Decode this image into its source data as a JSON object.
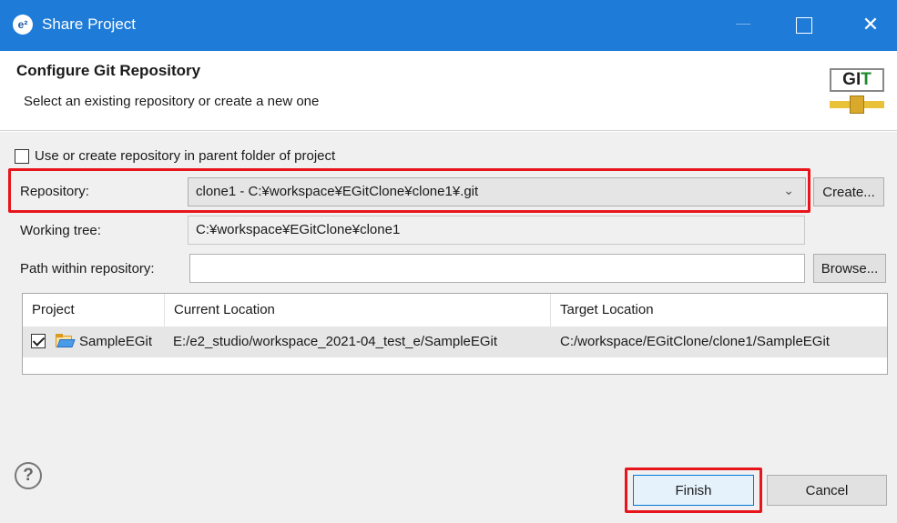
{
  "window": {
    "title": "Share Project",
    "app_icon_text": "e²",
    "close_glyph": "✕"
  },
  "banner": {
    "heading": "Configure Git Repository",
    "description": "Select an existing repository or create a new one",
    "logo_text_g": "G",
    "logo_text_i": "I",
    "logo_text_t": "T"
  },
  "form": {
    "use_parent_label": "Use or create repository in parent folder of project",
    "use_parent_checked": false,
    "repository_label": "Repository:",
    "repository_value": "clone1 - C:¥workspace¥EGitClone¥clone1¥.git",
    "create_button": "Create...",
    "working_tree_label": "Working tree:",
    "working_tree_value": "C:¥workspace¥EGitClone¥clone1",
    "path_label": "Path within repository:",
    "path_value": "",
    "browse_button": "Browse..."
  },
  "table": {
    "columns": [
      "Project",
      "Current Location",
      "Target Location"
    ],
    "rows": [
      {
        "checked": true,
        "project": "SampleEGit",
        "current_location": "E:/e2_studio/workspace_2021-04_test_e/SampleEGit",
        "target_location": "C:/workspace/EGitClone/clone1/SampleEGit"
      }
    ]
  },
  "footer": {
    "help_glyph": "?",
    "finish_button": "Finish",
    "cancel_button": "Cancel"
  },
  "colors": {
    "titlebar": "#1e7bd8",
    "highlight": "#e8141b",
    "dialog_bg": "#f0f0f0"
  },
  "icons": {
    "app": "eclipse-e2-icon",
    "logo": "git-logo",
    "folder": "project-folder-icon",
    "dropdown": "chevron-down-icon",
    "help": "help-icon"
  }
}
